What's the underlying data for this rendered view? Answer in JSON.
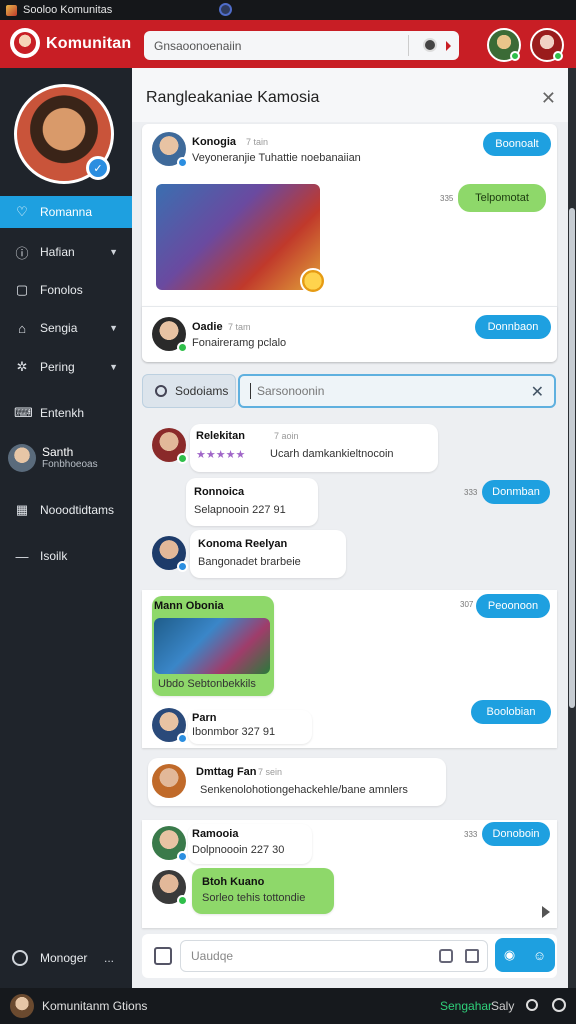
{
  "window": {
    "title": "Sooloo Komunitas"
  },
  "topbar": {
    "brand": "Komunitan",
    "search_value": "Gnsaoonoenaiin"
  },
  "sidebar": {
    "items": [
      {
        "label": "Romanna",
        "icon": "heart-icon",
        "active": true,
        "chevron": false
      },
      {
        "label": "Hafian",
        "icon": "info-circle-icon",
        "active": false,
        "chevron": true
      },
      {
        "label": "Fonolos",
        "icon": "document-icon",
        "active": false,
        "chevron": false
      },
      {
        "label": "Sengia",
        "icon": "home-icon",
        "active": false,
        "chevron": true
      },
      {
        "label": "Pering",
        "icon": "gear-icon",
        "active": false,
        "chevron": true
      },
      {
        "label": "Entenkh",
        "icon": "keyboard-icon",
        "active": false,
        "chevron": false
      }
    ],
    "user": {
      "name": "Santh",
      "subtitle": "Fonbhoeoas"
    },
    "items2": [
      {
        "label": "Nooodtidtams",
        "icon": "grid-icon"
      },
      {
        "label": "Isoilk",
        "icon": "dash-icon"
      }
    ],
    "bottom": {
      "label": "Monoger",
      "dots": "..."
    }
  },
  "main": {
    "title": "Rangleakaniae Kamosia",
    "post1": {
      "name": "Konogia",
      "time": "7 tain",
      "message": "Veyoneranjie  Tuhattie noebanaiian",
      "button": "Boonoalt",
      "green_button": "Telpomotat",
      "tiny": "335"
    },
    "post2": {
      "name": "Oadie",
      "time": "7 tam",
      "message": "Fonaireramg pclalo",
      "button": "Donnbaon"
    },
    "search": {
      "button": "Sodoiams",
      "placeholder": "Sarsonoonin"
    },
    "chat": [
      {
        "name": "Relekitan",
        "time": "7 aoin",
        "message": "Ucarh damkankieltnocoin"
      },
      {
        "name": "Ronnoica",
        "message": "Selapnooin 227 91",
        "button": "Donmban",
        "tiny": "333"
      },
      {
        "name": "Konoma Reelyan",
        "message": "Bangonadet brarbeie"
      }
    ],
    "card3": {
      "name": "Mann Obonia",
      "caption": "Ubdo Sebtonbekkils",
      "button": "Peoonoon",
      "tiny": "307",
      "user2": "Parn",
      "user2_msg": "Ibonmbor 327 91",
      "user2_button": "Boolobian"
    },
    "card4": {
      "name": "Dmttag Fan",
      "time": "7 sein",
      "message": "Senkenolohotiongehackehle/bane amnlers"
    },
    "card5": {
      "name": "Ramooia",
      "message": "Dolpnoooin 227 30",
      "button": "Donoboin",
      "tiny": "333",
      "user2": "Btoh Kuano",
      "user2_msg": "Sorleo tehis tottondie"
    },
    "composer": {
      "placeholder": "Uaudqe"
    }
  },
  "taskbar": {
    "left": "Komunitanm Gtions",
    "right_green": "Sengahar",
    "right": "Saly"
  },
  "colors": {
    "brand_red": "#c81e25",
    "accent_blue": "#1ea0e0",
    "accent_green": "#8ed86a",
    "sidebar_bg": "#1f242b"
  }
}
